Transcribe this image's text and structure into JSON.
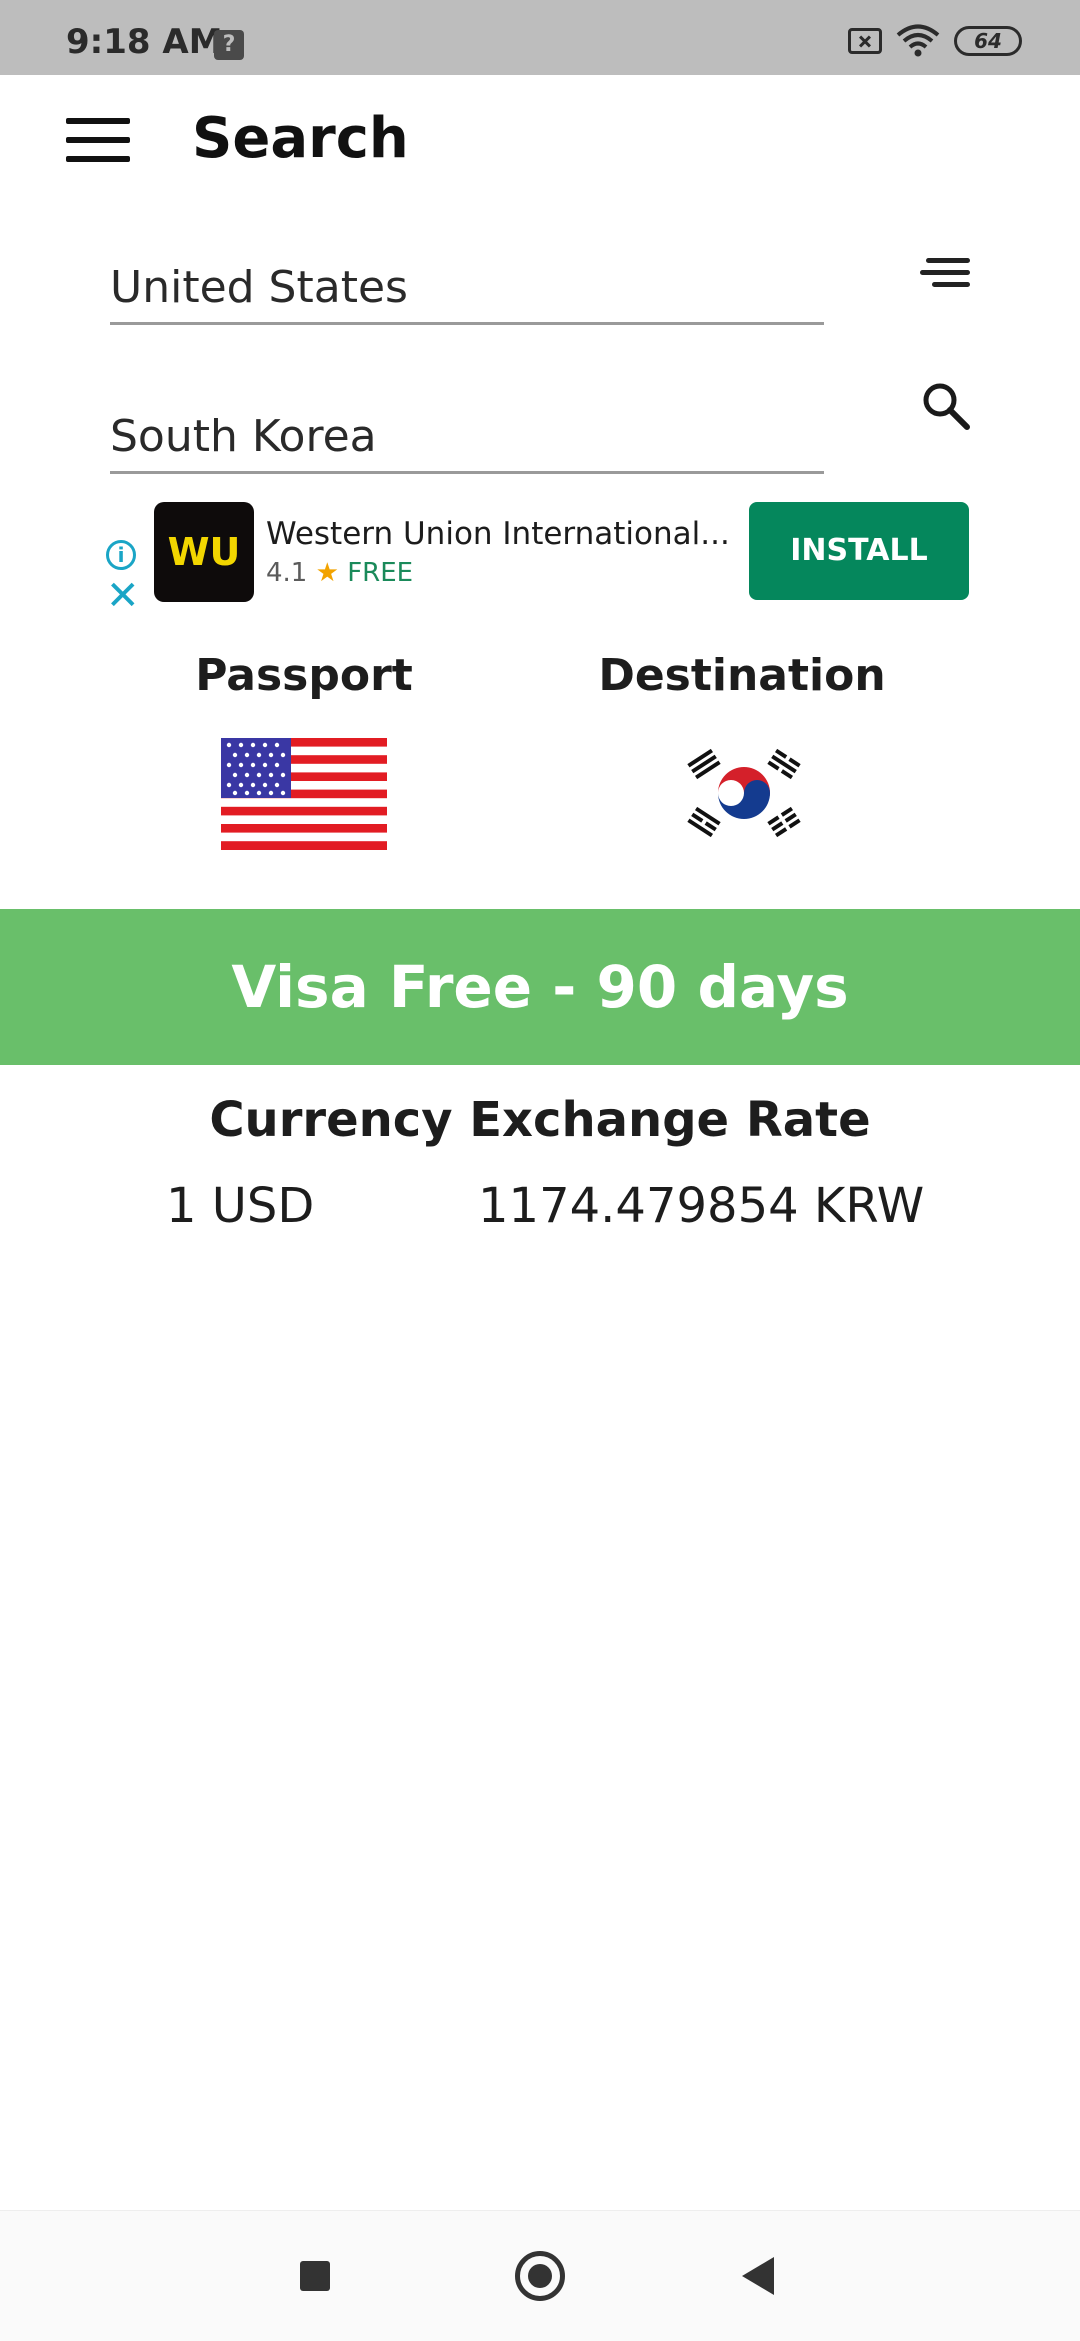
{
  "status_bar": {
    "time": "9:18 AM",
    "notification_icon": "?",
    "battery": "64"
  },
  "app_bar": {
    "title": "Search",
    "menu_icon": "hamburger-menu-icon"
  },
  "search": {
    "passport_country": "United States",
    "destination_country": "South Korea",
    "filter_icon": "sort-lines-icon",
    "search_icon": "search-icon"
  },
  "ad": {
    "logo_text": "WU",
    "title": "Western Union International...",
    "rating": "4.1",
    "star": "★",
    "price": "FREE",
    "install_label": "INSTALL",
    "info_icon": "i",
    "close_icon": "✕"
  },
  "result": {
    "passport_label": "Passport",
    "destination_label": "Destination",
    "visa_status": "Visa Free - 90 days",
    "banner_color": "#69bf6a"
  },
  "currency": {
    "title": "Currency Exchange Rate",
    "from": "1 USD",
    "to": "1174.479854 KRW"
  }
}
